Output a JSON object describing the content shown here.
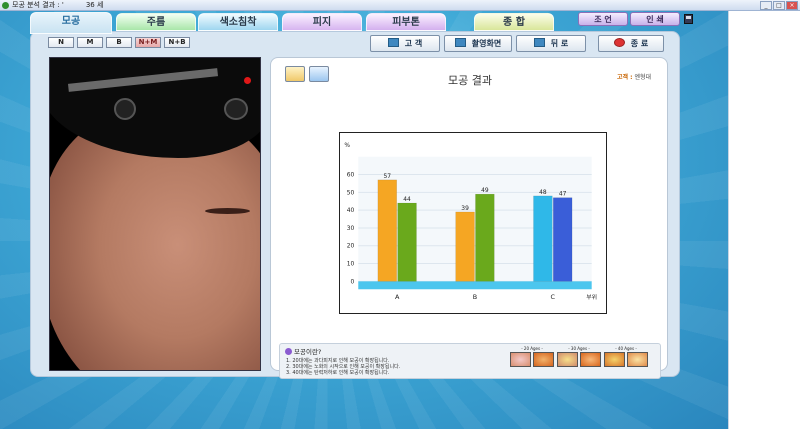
{
  "window": {
    "title": "모공 분석 결과 : '",
    "title_suffix": "36 세",
    "buttons": [
      "_",
      "□",
      "×"
    ]
  },
  "tabs": [
    {
      "label": "모공",
      "active": true
    },
    {
      "label": "주름"
    },
    {
      "label": "색소침착"
    },
    {
      "label": "피지"
    },
    {
      "label": "피부톤"
    },
    {
      "label": "종 합"
    }
  ],
  "top_buttons": {
    "customer": "조 언",
    "print": "인 쇄"
  },
  "modes": [
    {
      "label": "N"
    },
    {
      "label": "M"
    },
    {
      "label": "B"
    },
    {
      "label": "N+M",
      "active": true
    },
    {
      "label": "N+B"
    }
  ],
  "actions": {
    "customer": "고 객",
    "capture": "촬영화면",
    "back": "뒤 로",
    "exit": "종 료"
  },
  "result": {
    "title": "모공 결과",
    "customer_label": "고객 :",
    "customer_name": "엔형대"
  },
  "chart_data": {
    "type": "bar",
    "categories": [
      "A",
      "B",
      "C"
    ],
    "series": [
      {
        "values": [
          57,
          39,
          48
        ],
        "colors": [
          "#f5a623",
          "#f5a623",
          "#2fb8e8"
        ]
      },
      {
        "values": [
          44,
          49,
          47
        ],
        "colors": [
          "#6aa91c",
          "#6aa91c",
          "#3a5ed8"
        ]
      }
    ],
    "ylabel": "%",
    "xlabel": "부위",
    "yticks": [
      0,
      10,
      20,
      30,
      40,
      50,
      60
    ],
    "ylim": [
      0,
      70
    ],
    "grid": true
  },
  "info": {
    "question": "모공이란?",
    "lines": [
      "1. 20대에는 과다피지로 인해 모공이 확장됩니다.",
      "2. 30대에는 노화의 시작으로 인해 모공이 확장됩니다.",
      "3. 40대에는 탄력저하로 인해 모공이 확장됩니다."
    ],
    "ages": [
      "- 20 Ages -",
      "- 30 Ages -",
      "- 40 Ages -"
    ]
  }
}
